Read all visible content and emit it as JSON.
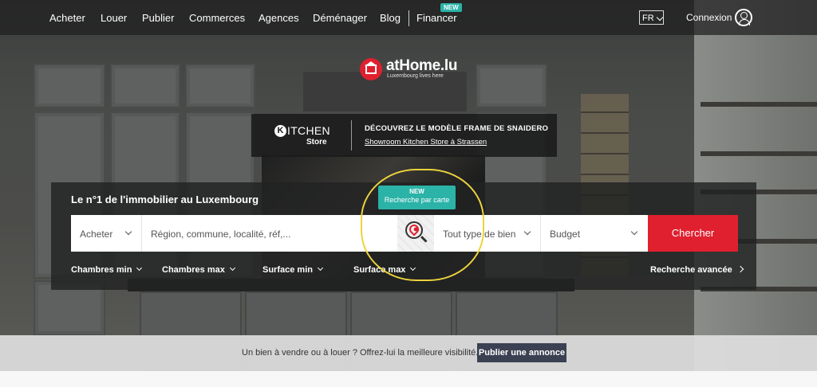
{
  "nav": {
    "items": [
      {
        "label": "Acheter"
      },
      {
        "label": "Louer"
      },
      {
        "label": "Publier"
      },
      {
        "label": "Commerces"
      },
      {
        "label": "Agences"
      },
      {
        "label": "Déménager"
      },
      {
        "label": "Blog"
      },
      {
        "label": "Financer"
      }
    ],
    "financer_badge": "NEW",
    "language": "FR",
    "login_label": "Connexion"
  },
  "logo": {
    "name": "atHome.lu",
    "tagline": "Luxembourg lives here"
  },
  "ad": {
    "brand_letter": "K",
    "brand_rest": "ITCHEN",
    "brand_sub": "Store",
    "headline": "DÉCOUVREZ LE MODÈLE FRAME DE SNAIDERO",
    "link": "Showroom Kitchen Store à Strassen"
  },
  "search": {
    "title": "Le n°1 de l'immobilier au Luxembourg",
    "map_badge_line1": "NEW",
    "map_badge_line2": "Recherche par carte",
    "transaction": "Acheter",
    "location_placeholder": "Région, commune, localité, réf,...",
    "property_type": "Tout type de bien",
    "budget": "Budget",
    "submit": "Chercher",
    "filters": [
      "Chambres min",
      "Chambres max",
      "Surface min",
      "Surface max"
    ],
    "advanced": "Recherche avancée"
  },
  "publish": {
    "text": "Un bien à vendre ou à louer ? Offrez-lui la meilleure visibilité.",
    "button": "Publier une annonce"
  },
  "colors": {
    "brand_red": "#e0202f",
    "teal_badge": "#2bb3a8",
    "publish_button": "#3b4153",
    "highlight_yellow": "#ecd33d"
  }
}
